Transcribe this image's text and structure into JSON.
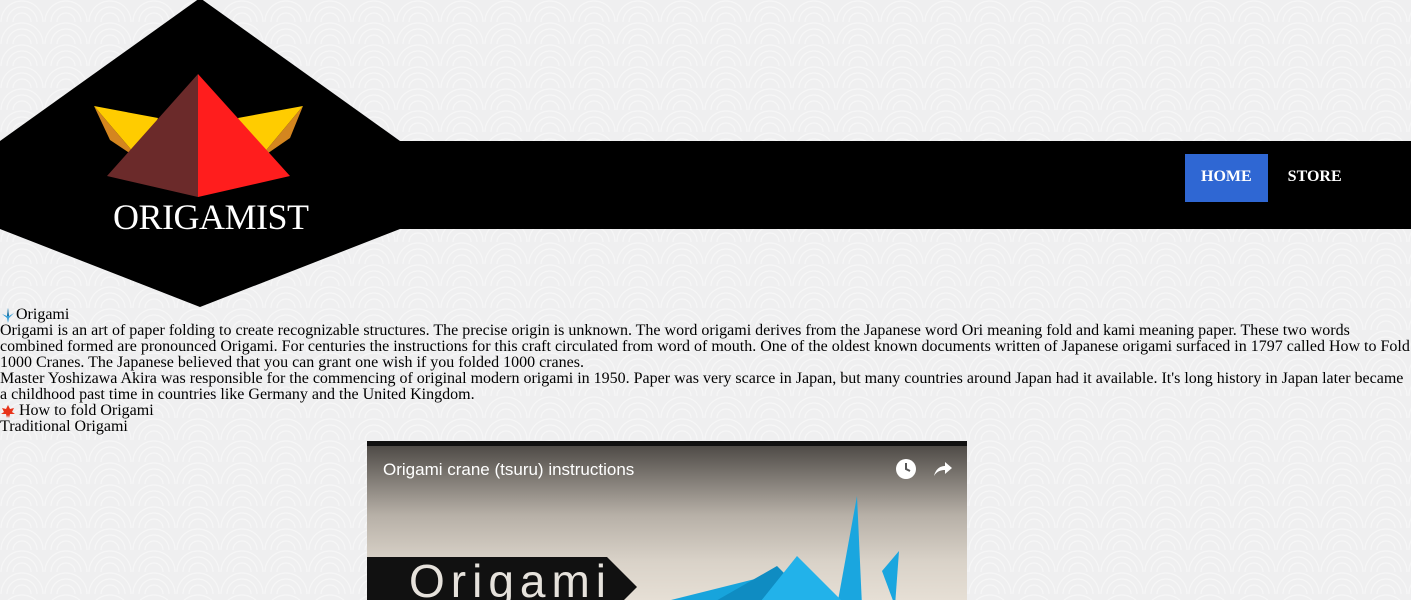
{
  "brand": {
    "name": "ORIGAMIST"
  },
  "nav": {
    "items": [
      {
        "label": "HOME",
        "active": true
      },
      {
        "label": "STORE",
        "active": false
      }
    ]
  },
  "colors": {
    "nav_active": "#2f67d3",
    "header_bar": "#000000",
    "logo_red": "#ff1d1d",
    "logo_dark_red": "#6b2a2a",
    "logo_yellow": "#ffcc00",
    "logo_orange": "#d4861f"
  },
  "content": {
    "section1": {
      "icon": "crane-icon",
      "title": "Origami",
      "paragraphs": [
        "Origami is an art of paper folding to create recognizable structures. The precise origin is unknown. The word origami derives from the Japanese word Ori meaning fold and kami meaning paper. These two words combined formed are pronounced Origami. For centuries the instructions for this craft circulated from word of mouth. One of the oldest known documents written of Japanese origami surfaced in 1797 called How to Fold 1000 Cranes. The Japanese believed that you can grant one wish if you folded 1000 cranes.",
        "Master Yoshizawa Akira was responsible for the commencing of original modern origami in 1950. Paper was very scarce in Japan, but many countries around Japan had it available. It's long history in Japan later became a childhood past time in countries like Germany and the United Kingdom."
      ]
    },
    "section2": {
      "icon": "maple-leaf-icon",
      "title": "How to fold Origami",
      "subtitle": "Traditional Origami"
    }
  },
  "video": {
    "title": "Origami crane (tsuru) instructions",
    "banner_text": "Origami",
    "icons": [
      "clock-icon",
      "share-icon"
    ]
  }
}
